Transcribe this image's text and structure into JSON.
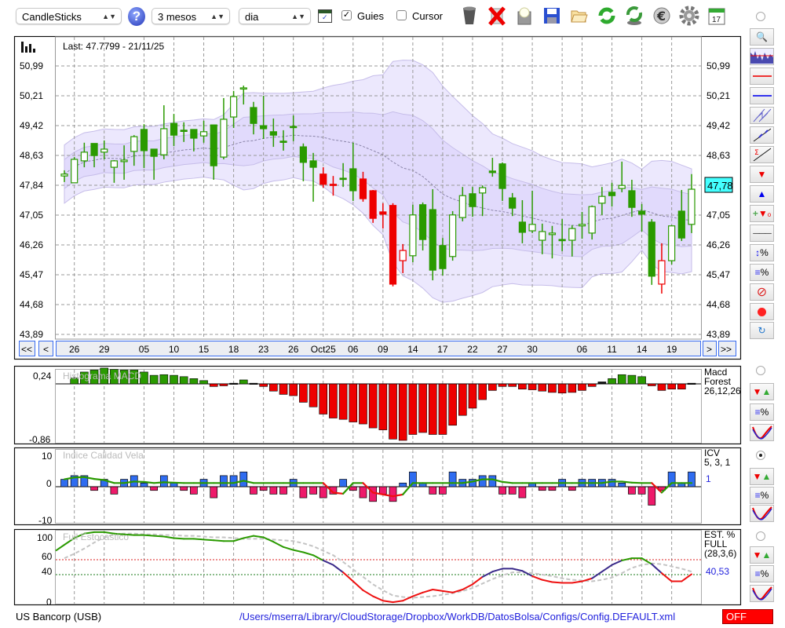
{
  "toolbar": {
    "chart_type": "CandleSticks",
    "period": "3 mesos",
    "interval": "dia",
    "guides_label": "Guies",
    "guides_checked": true,
    "cursor_label": "Cursor",
    "cursor_checked": false,
    "icons": [
      "help-icon",
      "chart-window-icon",
      "trash-icon",
      "delete-icon",
      "screenshot-icon",
      "save-icon",
      "open-folder-icon",
      "refresh-icon",
      "update-icon",
      "currency-icon",
      "settings-icon",
      "calendar-icon"
    ],
    "calendar_day": "17"
  },
  "main": {
    "last_label": "Last: 47.7799 - 21/11/25",
    "price_ticks_left": [
      "50,99",
      "50,21",
      "49,42",
      "48,63",
      "47,84",
      "47,05",
      "46,26",
      "45,47",
      "44,68",
      "43,89"
    ],
    "price_ticks_right": [
      "50,99",
      "50,21",
      "49,42",
      "48,63",
      "",
      "47,05",
      "46,26",
      "45,47",
      "44,68",
      "43,89"
    ],
    "current_price": "47,78",
    "nav": {
      "first": "<<",
      "prev": "<",
      "next": ">",
      "last": ">>"
    },
    "date_ticks": [
      {
        "i": 1,
        "label": "26"
      },
      {
        "i": 4,
        "label": "29"
      },
      {
        "i": 8,
        "label": "05"
      },
      {
        "i": 11,
        "label": "10"
      },
      {
        "i": 14,
        "label": "15"
      },
      {
        "i": 17,
        "label": "18"
      },
      {
        "i": 20,
        "label": "23"
      },
      {
        "i": 23,
        "label": "26"
      },
      {
        "i": 26,
        "label": "Oct25"
      },
      {
        "i": 29,
        "label": "06"
      },
      {
        "i": 32,
        "label": "09"
      },
      {
        "i": 35,
        "label": "14"
      },
      {
        "i": 38,
        "label": "17"
      },
      {
        "i": 41,
        "label": "22"
      },
      {
        "i": 44,
        "label": "27"
      },
      {
        "i": 47,
        "label": "30"
      },
      {
        "i": 50,
        "label": ""
      },
      {
        "i": 52,
        "label": "06"
      },
      {
        "i": 55,
        "label": "11"
      },
      {
        "i": 58,
        "label": "14"
      },
      {
        "i": 61,
        "label": "19"
      }
    ]
  },
  "colors": {
    "up": "#2a9a00",
    "down": "#ee0000",
    "band_outer": "#ece8fd",
    "band_inner": "#e1dafc",
    "band_stroke": "#c6bde9",
    "accent": "#3a6df0",
    "current_bg": "#44ffff"
  },
  "candles": [
    [
      48.08,
      48.23,
      47.92,
      48.13,
      "g"
    ],
    [
      47.9,
      48.58,
      47.9,
      48.52,
      "g"
    ],
    [
      48.48,
      48.96,
      48.31,
      48.71,
      "g"
    ],
    [
      48.94,
      48.94,
      48.31,
      48.62,
      "g"
    ],
    [
      48.71,
      49.02,
      48.52,
      48.79,
      "g"
    ],
    [
      48.31,
      48.5,
      47.9,
      48.48,
      "g"
    ],
    [
      48.46,
      48.89,
      47.98,
      48.5,
      "g"
    ],
    [
      48.73,
      49.16,
      48.35,
      49.12,
      "g"
    ],
    [
      49.31,
      49.45,
      48.29,
      48.75,
      "g"
    ],
    [
      48.79,
      48.79,
      47.98,
      48.6,
      "g"
    ],
    [
      48.64,
      49.95,
      48.52,
      49.33,
      "g"
    ],
    [
      49.47,
      49.72,
      48.87,
      49.16,
      "g"
    ],
    [
      49.29,
      49.5,
      48.98,
      49.27,
      "g"
    ],
    [
      49.31,
      49.31,
      48.73,
      49.08,
      "g"
    ],
    [
      49.14,
      49.54,
      48.96,
      49.25,
      "g"
    ],
    [
      49.43,
      49.43,
      47.98,
      48.35,
      "g"
    ],
    [
      48.58,
      50.14,
      48.52,
      49.58,
      "g"
    ],
    [
      49.64,
      50.33,
      49.35,
      50.18,
      "g"
    ],
    [
      50.39,
      50.47,
      49.97,
      50.41,
      "g"
    ],
    [
      49.89,
      50.04,
      49.18,
      49.47,
      "g"
    ],
    [
      49.41,
      50.2,
      49.06,
      49.33,
      "g"
    ],
    [
      49.25,
      49.6,
      48.85,
      49.16,
      "g"
    ],
    [
      49.0,
      49.29,
      48.75,
      49.0,
      "g"
    ],
    [
      49.39,
      49.68,
      49.0,
      49.37,
      "g"
    ],
    [
      48.85,
      48.94,
      47.94,
      48.44,
      "g"
    ],
    [
      48.48,
      48.69,
      47.4,
      48.31,
      "g"
    ],
    [
      48.13,
      48.31,
      47.77,
      47.86,
      "r"
    ],
    [
      47.86,
      48.08,
      47.56,
      47.83,
      "r"
    ],
    [
      48.02,
      48.42,
      47.79,
      48.0,
      "g"
    ],
    [
      48.27,
      48.96,
      47.42,
      47.69,
      "g"
    ],
    [
      48.0,
      48.19,
      47.4,
      47.48,
      "r"
    ],
    [
      47.69,
      47.71,
      46.84,
      46.96,
      "r"
    ],
    [
      47.13,
      47.36,
      46.69,
      47.07,
      "r"
    ],
    [
      47.3,
      47.36,
      45.16,
      45.22,
      "r"
    ],
    [
      45.84,
      46.28,
      45.51,
      46.11,
      "r"
    ],
    [
      45.97,
      47.32,
      45.8,
      47.05,
      "g"
    ],
    [
      47.32,
      47.38,
      46.11,
      46.4,
      "g"
    ],
    [
      47.19,
      47.73,
      45.32,
      45.59,
      "g"
    ],
    [
      46.24,
      46.44,
      45.45,
      45.63,
      "g"
    ],
    [
      45.95,
      47.15,
      45.84,
      47.05,
      "g"
    ],
    [
      46.98,
      47.79,
      46.88,
      47.56,
      "g"
    ],
    [
      47.61,
      47.79,
      47.0,
      47.27,
      "g"
    ],
    [
      47.63,
      47.83,
      47.02,
      47.77,
      "g"
    ],
    [
      48.21,
      48.56,
      48.06,
      48.17,
      "g"
    ],
    [
      48.4,
      48.44,
      47.42,
      47.75,
      "g"
    ],
    [
      47.5,
      47.63,
      47.02,
      47.23,
      "g"
    ],
    [
      46.86,
      47.44,
      46.3,
      46.59,
      "g"
    ],
    [
      46.63,
      47.69,
      46.57,
      46.8,
      "g"
    ],
    [
      46.38,
      46.82,
      46.01,
      46.61,
      "g"
    ],
    [
      46.53,
      46.76,
      45.9,
      46.57,
      "g"
    ],
    [
      46.4,
      46.94,
      46.09,
      46.4,
      "g"
    ],
    [
      46.38,
      46.78,
      45.95,
      46.69,
      "g"
    ],
    [
      46.76,
      47.13,
      46.42,
      46.8,
      "g"
    ],
    [
      46.57,
      47.3,
      46.4,
      47.27,
      "g"
    ],
    [
      47.36,
      47.79,
      47.05,
      47.54,
      "g"
    ],
    [
      47.65,
      47.9,
      47.27,
      47.56,
      "g"
    ],
    [
      47.75,
      48.46,
      47.65,
      47.83,
      "g"
    ],
    [
      47.69,
      47.98,
      47.0,
      47.25,
      "g"
    ],
    [
      47.15,
      47.34,
      46.61,
      47.07,
      "g"
    ],
    [
      46.86,
      46.94,
      45.2,
      45.43,
      "g"
    ],
    [
      45.22,
      46.3,
      44.97,
      45.84,
      "r"
    ],
    [
      45.84,
      46.78,
      45.74,
      46.76,
      "g"
    ],
    [
      47.15,
      47.71,
      46.36,
      46.44,
      "g"
    ],
    [
      46.8,
      48.13,
      46.57,
      47.73,
      "g"
    ]
  ],
  "macd": {
    "title": "Histograma MACD",
    "ticks": [
      "0,24",
      "-0,86"
    ],
    "legend": [
      "Macd",
      "Forest",
      "26,12,26"
    ],
    "values": [
      null,
      0.09,
      0.18,
      0.21,
      0.24,
      0.22,
      0.21,
      0.21,
      0.18,
      0.13,
      0.14,
      0.13,
      0.11,
      0.08,
      0.05,
      -0.04,
      -0.03,
      0.01,
      0.06,
      0.01,
      -0.04,
      -0.11,
      -0.16,
      -0.18,
      -0.28,
      -0.35,
      -0.46,
      -0.52,
      -0.54,
      -0.58,
      -0.61,
      -0.67,
      -0.7,
      -0.84,
      -0.86,
      -0.77,
      -0.74,
      -0.77,
      -0.77,
      -0.63,
      -0.48,
      -0.37,
      -0.24,
      -0.1,
      -0.04,
      -0.04,
      -0.08,
      -0.09,
      -0.11,
      -0.13,
      -0.14,
      -0.13,
      -0.1,
      -0.04,
      0.03,
      0.08,
      0.14,
      0.13,
      0.11,
      -0.03,
      -0.1,
      -0.08,
      -0.08,
      0.01
    ]
  },
  "icv": {
    "title": "Indice Calidad Vela",
    "ticks": [
      "10",
      "0",
      "-10"
    ],
    "legend": [
      "ICV",
      "5, 3, 1"
    ],
    "current": "1",
    "bars": [
      2,
      3,
      3,
      -1,
      2,
      -2,
      2,
      3,
      1,
      -1,
      3,
      1,
      -1,
      -2,
      2,
      -3,
      3,
      3,
      4,
      -2,
      -1,
      -2,
      -2,
      2,
      -3,
      -2,
      -3,
      -2,
      2,
      -1,
      -3,
      -4,
      -2,
      -4,
      1,
      4,
      1,
      -2,
      -2,
      4,
      2,
      2,
      3,
      3,
      -2,
      -2,
      -3,
      1,
      -1,
      -1,
      2,
      -1,
      2,
      2,
      2,
      2,
      1,
      -2,
      -2,
      -5,
      -1,
      4,
      1,
      4
    ],
    "line": [
      2,
      2.5,
      2.6,
      2.1,
      1.8,
      1,
      1,
      1.4,
      1.3,
      1,
      1.2,
      1.1,
      1,
      1,
      1,
      1,
      1,
      1,
      1.6,
      1,
      1,
      1,
      1,
      1,
      1,
      1,
      1,
      -1.6,
      -1.9,
      1,
      1,
      -1.6,
      -2.1,
      -2.6,
      -2.1,
      1,
      1,
      1,
      1,
      1,
      1,
      1.4,
      2,
      2,
      1.3,
      1,
      1,
      1,
      1,
      1,
      1,
      1,
      1,
      1,
      1,
      1.4,
      1.4,
      1.1,
      1,
      1,
      -1.6,
      1,
      1,
      1
    ]
  },
  "stoch": {
    "title": "Full Estocastico",
    "ticks": [
      "100",
      "60",
      "40",
      "0"
    ],
    "legend": [
      "EST. %",
      "FULL",
      "(28,3,6)"
    ],
    "current": "40,53",
    "levels": [
      60,
      40
    ],
    "k": [
      80,
      89,
      95,
      97,
      97,
      95,
      94,
      93,
      93,
      92,
      91,
      89,
      88,
      88,
      87,
      86,
      85,
      85,
      89,
      92,
      90,
      84,
      77,
      73,
      70,
      66,
      59,
      53,
      43,
      31,
      19,
      11,
      5,
      3,
      5,
      11,
      16,
      20,
      18,
      16,
      20,
      27,
      37,
      44,
      48,
      48,
      45,
      38,
      33,
      30,
      29,
      29,
      31,
      35,
      44,
      53,
      59,
      62,
      62,
      54,
      42,
      31,
      31,
      40.53
    ],
    "d": [
      62,
      68,
      75,
      83,
      90,
      94,
      95,
      95,
      94,
      94,
      93,
      93,
      92,
      92,
      91,
      90,
      90,
      89,
      88,
      88,
      88,
      87,
      86,
      85,
      82,
      78,
      72,
      66,
      57,
      47,
      37,
      27,
      19,
      12,
      10,
      9,
      10,
      11,
      13,
      15,
      18,
      22,
      28,
      34,
      39,
      43,
      43,
      42,
      40,
      38,
      35,
      33,
      32,
      31,
      33,
      36,
      42,
      49,
      53,
      55,
      54,
      51,
      48,
      44
    ]
  },
  "status": {
    "symbol": "US Bancorp (USB)",
    "config_path": "/Users/mserra/Library/CloudStorage/Dropbox/WorkDB/DatosBolsa/Configs/Config.DEFAULT.xml",
    "off_label": "OFF"
  }
}
